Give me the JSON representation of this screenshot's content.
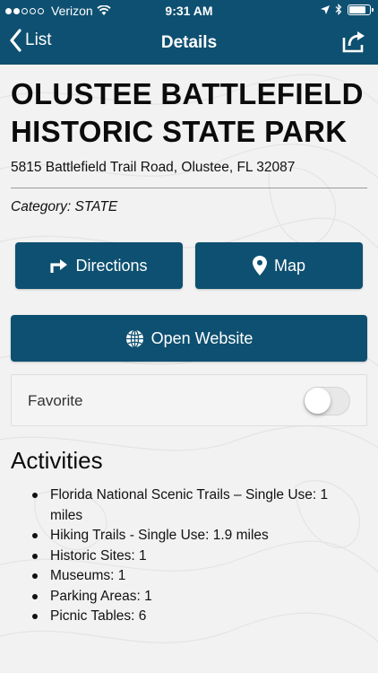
{
  "status_bar": {
    "carrier": "Verizon",
    "time": "9:31 AM",
    "battery_level": 0.85
  },
  "nav": {
    "back_label": "List",
    "title": "Details"
  },
  "park": {
    "name_line1": "OLUSTEE BATTLEFIELD",
    "name_line2": "HISTORIC STATE PARK",
    "address": "5815 Battlefield Trail Road, Olustee, FL 32087",
    "category": "Category: STATE"
  },
  "actions": {
    "directions_label": "Directions",
    "map_label": "Map",
    "website_label": "Open Website"
  },
  "favorite": {
    "label": "Favorite",
    "enabled": false
  },
  "activities": {
    "title": "Activities",
    "items": [
      "Florida National Scenic Trails – Single Use: 1 miles",
      "Hiking Trails - Single Use: 1.9 miles",
      "Historic Sites: 1",
      "Museums: 1",
      "Parking Areas: 1",
      "Picnic Tables: 6"
    ]
  },
  "colors": {
    "header": "#0e5071",
    "button": "#0e5071",
    "background": "#f2f2f2"
  }
}
